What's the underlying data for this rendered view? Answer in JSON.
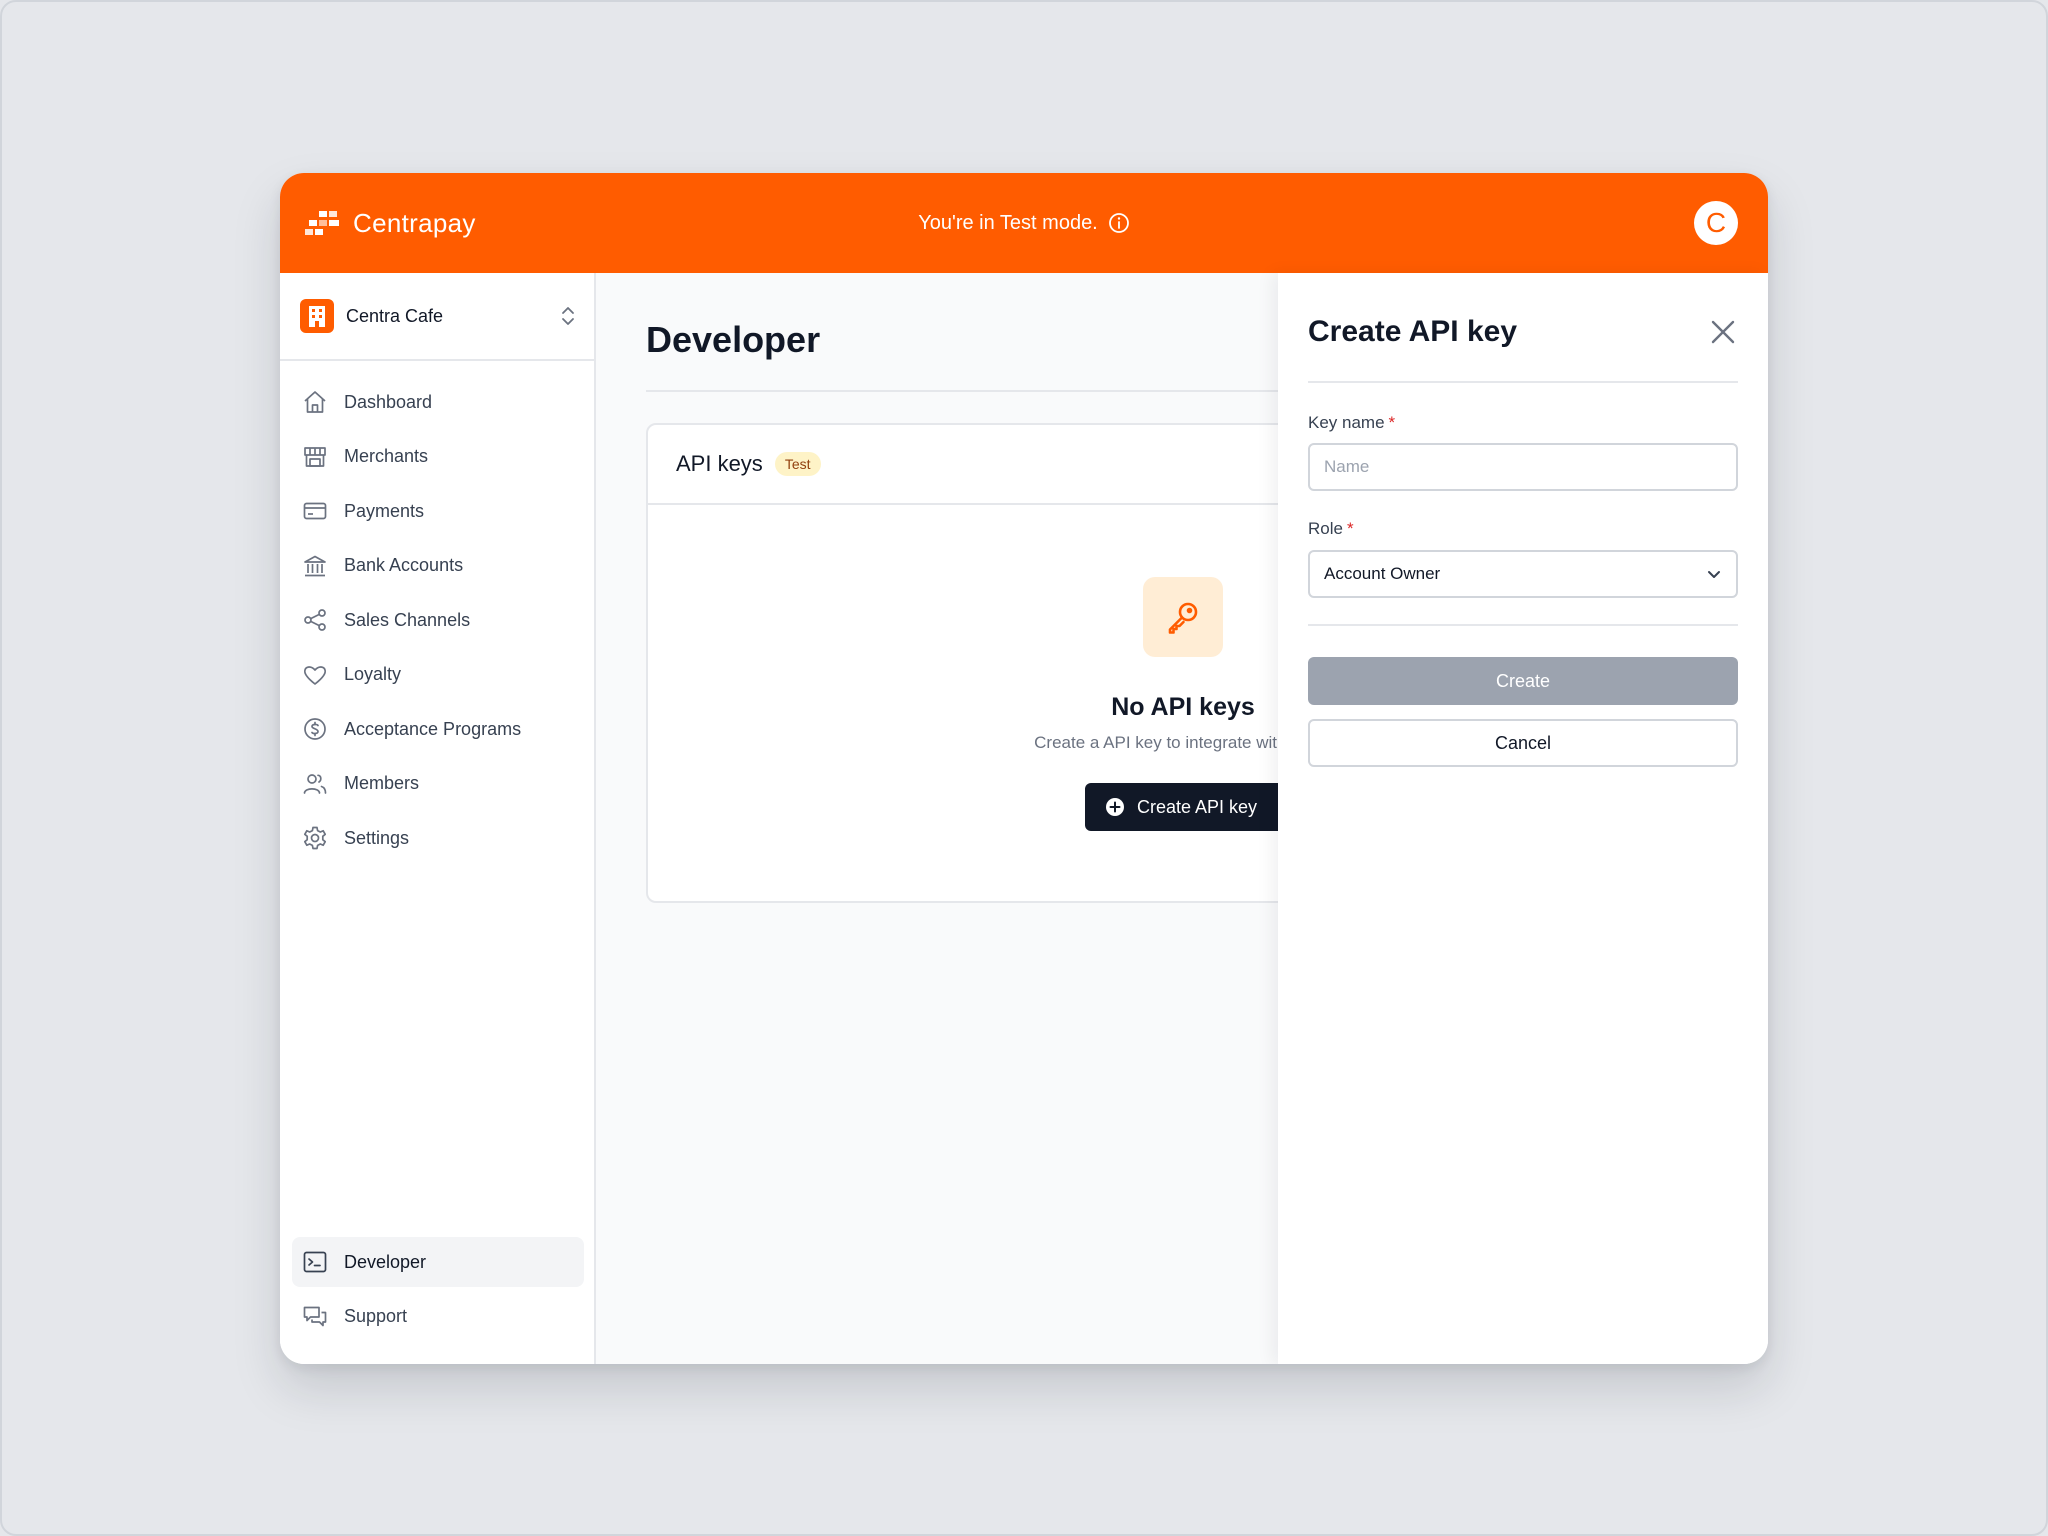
{
  "header": {
    "brand_name": "Centrapay",
    "test_mode_text": "You're in Test mode.",
    "avatar_initial": "C",
    "accent_color": "#ff5c00"
  },
  "sidebar": {
    "org_name": "Centra Cafe",
    "items": [
      {
        "label": "Dashboard",
        "icon": "home-icon"
      },
      {
        "label": "Merchants",
        "icon": "store-icon"
      },
      {
        "label": "Payments",
        "icon": "credit-card-icon"
      },
      {
        "label": "Bank Accounts",
        "icon": "bank-icon"
      },
      {
        "label": "Sales Channels",
        "icon": "share-icon"
      },
      {
        "label": "Loyalty",
        "icon": "heart-icon"
      },
      {
        "label": "Acceptance Programs",
        "icon": "dollar-circle-icon"
      },
      {
        "label": "Members",
        "icon": "users-icon"
      },
      {
        "label": "Settings",
        "icon": "gear-icon"
      }
    ],
    "bottom_items": [
      {
        "label": "Developer",
        "icon": "terminal-icon",
        "active": true
      },
      {
        "label": "Support",
        "icon": "chat-icon"
      }
    ]
  },
  "main": {
    "page_title": "Developer",
    "card_title": "API keys",
    "badge": "Test",
    "empty_title": "No API keys",
    "empty_description": "Create a API key to integrate with the C",
    "create_button": "Create API key"
  },
  "drawer": {
    "title": "Create API key",
    "key_name_label": "Key name",
    "key_name_placeholder": "Name",
    "key_name_value": "",
    "required_marker": "*",
    "role_label": "Role",
    "role_value": "Account Owner",
    "create_label": "Create",
    "cancel_label": "Cancel"
  }
}
